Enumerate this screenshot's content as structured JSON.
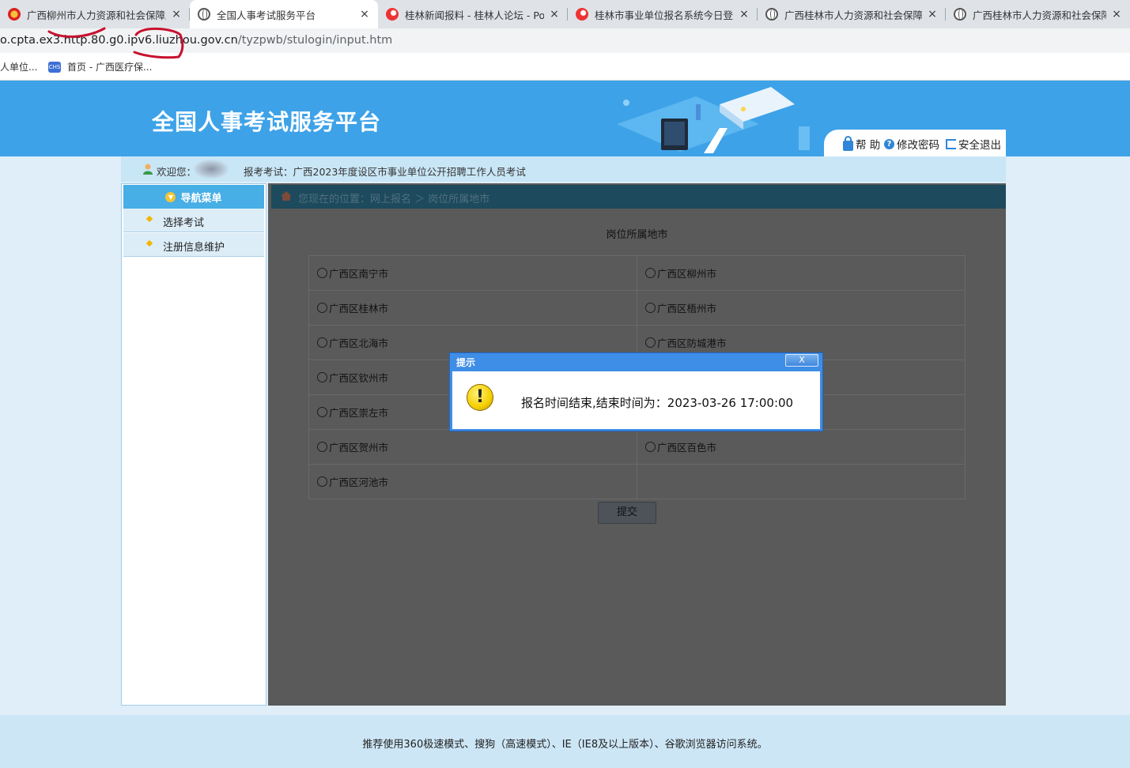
{
  "browser": {
    "tabs": [
      {
        "title": "广西柳州市人力资源和社会保障局",
        "icon": "emblem-icon",
        "state": "inactive"
      },
      {
        "title": "全国人事考试服务平台",
        "icon": "globe-icon",
        "state": "active"
      },
      {
        "title": "桂林新闻报料 - 桂林人论坛 - Po",
        "icon": "red-logo-icon",
        "state": "inactive"
      },
      {
        "title": "桂林市事业单位报名系统今日登",
        "icon": "red-logo-icon",
        "state": "inactive"
      },
      {
        "title": "广西桂林市人力资源和社会保障局",
        "icon": "globe-icon",
        "state": "inactive"
      },
      {
        "title": "广西桂林市人力资源和社会保障局",
        "icon": "globe-icon",
        "state": "inactive"
      }
    ],
    "close_glyph": "×",
    "url_main": "o.cpta.ex3.http.80.g0.ipv6.liuzhou.gov.cn",
    "url_path": "/tyzpwb/stulogin/input.htm",
    "bookmarks": [
      {
        "label": "人单位..."
      },
      {
        "label": "首页 - 广西医疗保...",
        "icon": "chs-icon"
      }
    ]
  },
  "site": {
    "title": "全国人事考试服务平台",
    "toolbar": {
      "help": "帮 助",
      "change_password": "修改密码",
      "logout": "安全退出"
    },
    "welcome_label": "欢迎您：",
    "exam_label": "报考考试：广西2023年度设区市事业单位公开招聘工作人员考试"
  },
  "nav": {
    "header": "导航菜单",
    "items": [
      "选择考试",
      "注册信息维护"
    ]
  },
  "main": {
    "breadcrumb": "您现在的位置：网上报名 ＞ 岗位所属地市",
    "form_title": "岗位所属地市",
    "cities": [
      [
        "广西区南宁市",
        "广西区柳州市"
      ],
      [
        "广西区桂林市",
        "广西区梧州市"
      ],
      [
        "广西区北海市",
        "广西区防城港市"
      ],
      [
        "广西区钦州市",
        ""
      ],
      [
        "广西区崇左市",
        ""
      ],
      [
        "广西区贺州市",
        "广西区百色市"
      ],
      [
        "广西区河池市",
        ""
      ]
    ],
    "submit": "提交"
  },
  "dialog": {
    "title": "提示",
    "close": "X",
    "message": "报名时间结束,结束时间为：2023-03-26 17:00:00",
    "icon": "warning-icon"
  },
  "footer": {
    "text": "推荐使用360极速模式、搜狗（高速模式）、IE（IE8及以上版本）、谷歌浏览器访问系统。"
  },
  "colors": {
    "header_blue": "#3da2e8",
    "welcome_bar": "#c9e6f6",
    "overlay_gray": "#5a5a5a",
    "dialog_blue": "#3e8de6",
    "annotation_red": "#c8102e"
  }
}
